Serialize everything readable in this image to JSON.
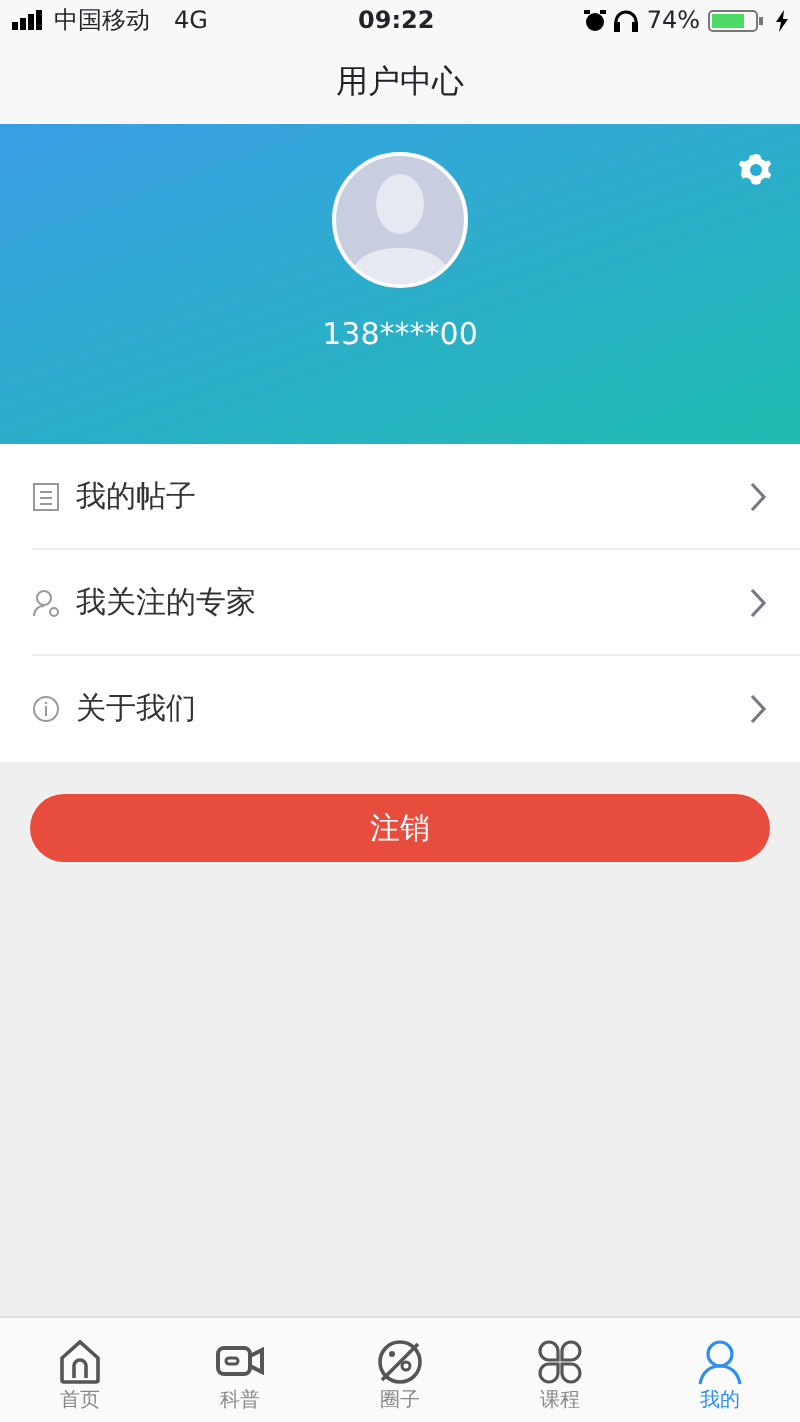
{
  "status_bar": {
    "carrier": "中国移动",
    "network": "4G",
    "time": "09:22",
    "battery": "74%"
  },
  "title": "用户中心",
  "profile": {
    "phone": "138****00"
  },
  "menu": [
    {
      "kind": "posts",
      "label": "我的帖子"
    },
    {
      "kind": "experts",
      "label": "我关注的专家"
    },
    {
      "kind": "about",
      "label": "关于我们"
    }
  ],
  "logout_button": "注销",
  "tabs": [
    {
      "kind": "home",
      "label": "首页",
      "selected": false
    },
    {
      "kind": "video",
      "label": "科普",
      "selected": false
    },
    {
      "kind": "planet",
      "label": "圈子",
      "selected": false
    },
    {
      "kind": "clover",
      "label": "课程",
      "selected": false
    },
    {
      "kind": "user",
      "label": "我的",
      "selected": true
    }
  ]
}
